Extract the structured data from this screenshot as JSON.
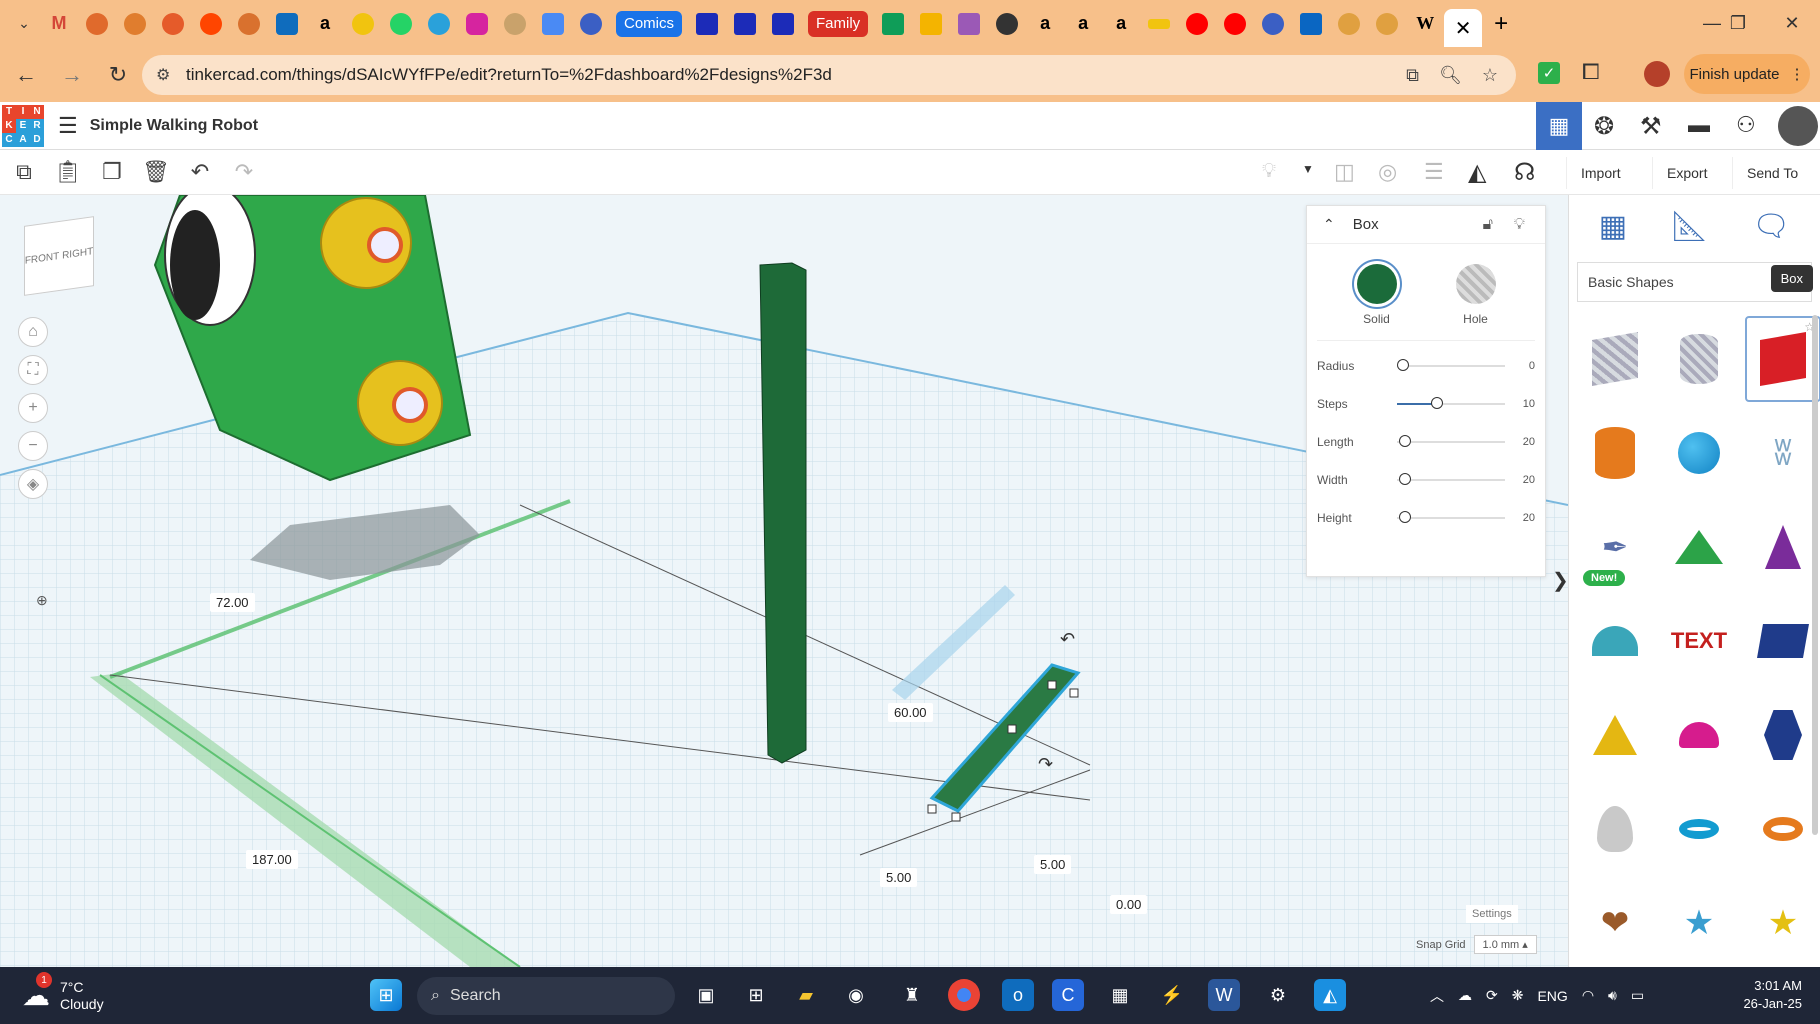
{
  "browser": {
    "tabs": [
      "Comics",
      "Family"
    ],
    "url": "tinkercad.com/things/dSAIcWYfFPe/edit?returnTo=%2Fdashboard%2Fdesigns%2F3d",
    "finish_update_label": "Finish update"
  },
  "app": {
    "logo_letters": [
      "T",
      "I",
      "N",
      "K",
      "E",
      "R",
      "C",
      "A",
      "D"
    ],
    "title": "Simple Walking Robot"
  },
  "toolbar": {
    "import_label": "Import",
    "export_label": "Export",
    "send_to_label": "Send To"
  },
  "inspector": {
    "title": "Box",
    "solid_label": "Solid",
    "hole_label": "Hole",
    "solid_color": "#1b6b3a",
    "params": [
      {
        "label": "Radius",
        "value": "0",
        "fraction": 0.0
      },
      {
        "label": "Steps",
        "value": "10",
        "fraction": 0.45
      },
      {
        "label": "Length",
        "value": "20",
        "fraction": 0.05
      },
      {
        "label": "Width",
        "value": "20",
        "fraction": 0.05
      },
      {
        "label": "Height",
        "value": "20",
        "fraction": 0.05
      }
    ]
  },
  "viewcube": {
    "front": "FRONT",
    "right": "RIGHT"
  },
  "dimensions": {
    "d72": "72.00",
    "d187": "187.00",
    "d60": "60.00",
    "d5a": "5.00",
    "d5b": "5.00",
    "d0": "0.00"
  },
  "workplane": {
    "settings_label": "Settings",
    "snap_grid_label": "Snap Grid",
    "snap_grid_value": "1.0 mm"
  },
  "shapes_panel": {
    "category": "Basic Shapes",
    "tooltip": "Box",
    "new_badge": "New!"
  },
  "taskbar": {
    "weather_temp": "7°C",
    "weather_desc": "Cloudy",
    "weather_badge": "1",
    "search_label": "Search",
    "language": "ENG",
    "time": "3:01 AM",
    "date": "26-Jan-25"
  }
}
